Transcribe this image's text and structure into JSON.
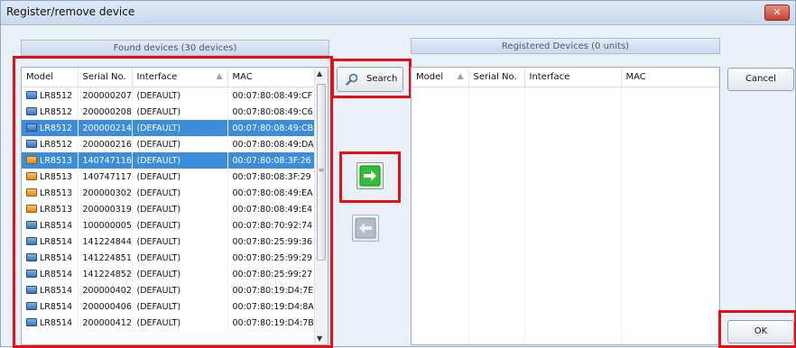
{
  "window": {
    "title": "Register/remove device",
    "close_glyph": "✕"
  },
  "found": {
    "caption": "Found devices (30 devices)",
    "columns": [
      "Model",
      "Serial No.",
      "Interface",
      "MAC"
    ],
    "rows": [
      {
        "model": "LR8512",
        "serial": "200000207",
        "iface": "(DEFAULT)",
        "mac": "00:07:80:08:49:CF",
        "selected": false,
        "icon": "blue"
      },
      {
        "model": "LR8512",
        "serial": "200000208",
        "iface": "(DEFAULT)",
        "mac": "00:07:80:08:49:C6",
        "selected": false,
        "icon": "blue"
      },
      {
        "model": "LR8512",
        "serial": "200000214",
        "iface": "(DEFAULT)",
        "mac": "00:07:80:08:49:CB",
        "selected": true,
        "icon": "blue"
      },
      {
        "model": "LR8512",
        "serial": "200000216",
        "iface": "(DEFAULT)",
        "mac": "00:07:80:08:49:DA",
        "selected": false,
        "icon": "blue"
      },
      {
        "model": "LR8513",
        "serial": "140747116",
        "iface": "(DEFAULT)",
        "mac": "00:07:80:08:3F:26",
        "selected": true,
        "icon": "orange"
      },
      {
        "model": "LR8513",
        "serial": "140747117",
        "iface": "(DEFAULT)",
        "mac": "00:07:80:08:3F:29",
        "selected": false,
        "icon": "orange"
      },
      {
        "model": "LR8513",
        "serial": "200000302",
        "iface": "(DEFAULT)",
        "mac": "00:07:80:08:49:EA",
        "selected": false,
        "icon": "orange"
      },
      {
        "model": "LR8513",
        "serial": "200000319",
        "iface": "(DEFAULT)",
        "mac": "00:07:80:08:49:E4",
        "selected": false,
        "icon": "orange"
      },
      {
        "model": "LR8514",
        "serial": "100000005",
        "iface": "(DEFAULT)",
        "mac": "00:07:80:70:92:74",
        "selected": false,
        "icon": "blue"
      },
      {
        "model": "LR8514",
        "serial": "141224844",
        "iface": "(DEFAULT)",
        "mac": "00:07:80:25:99:36",
        "selected": false,
        "icon": "blue"
      },
      {
        "model": "LR8514",
        "serial": "141224851",
        "iface": "(DEFAULT)",
        "mac": "00:07:80:25:99:29",
        "selected": false,
        "icon": "blue"
      },
      {
        "model": "LR8514",
        "serial": "141224852",
        "iface": "(DEFAULT)",
        "mac": "00:07:80:25:99:27",
        "selected": false,
        "icon": "blue"
      },
      {
        "model": "LR8514",
        "serial": "200000402",
        "iface": "(DEFAULT)",
        "mac": "00:07:80:19:D4:7E",
        "selected": false,
        "icon": "blue"
      },
      {
        "model": "LR8514",
        "serial": "200000406",
        "iface": "(DEFAULT)",
        "mac": "00:07:80:19:D4:8A",
        "selected": false,
        "icon": "blue"
      },
      {
        "model": "LR8514",
        "serial": "200000412",
        "iface": "(DEFAULT)",
        "mac": "00:07:80:19:D4:7B",
        "selected": false,
        "icon": "blue"
      }
    ]
  },
  "registered": {
    "caption": "Registered Devices (0 units)",
    "columns": [
      "Model",
      "Serial No.",
      "Interface",
      "MAC"
    ]
  },
  "buttons": {
    "search": "Search",
    "cancel": "Cancel",
    "ok": "OK"
  },
  "colors": {
    "highlight": "#e80e16",
    "selection": "#3c8cdc",
    "add_arrow": "#2fbf3a"
  },
  "icons": {
    "search": "magnifier-icon",
    "add": "green-right-arrow-icon",
    "remove": "gray-left-arrow-icon",
    "device": "device-icon",
    "sort": "sort-ascending-icon"
  }
}
